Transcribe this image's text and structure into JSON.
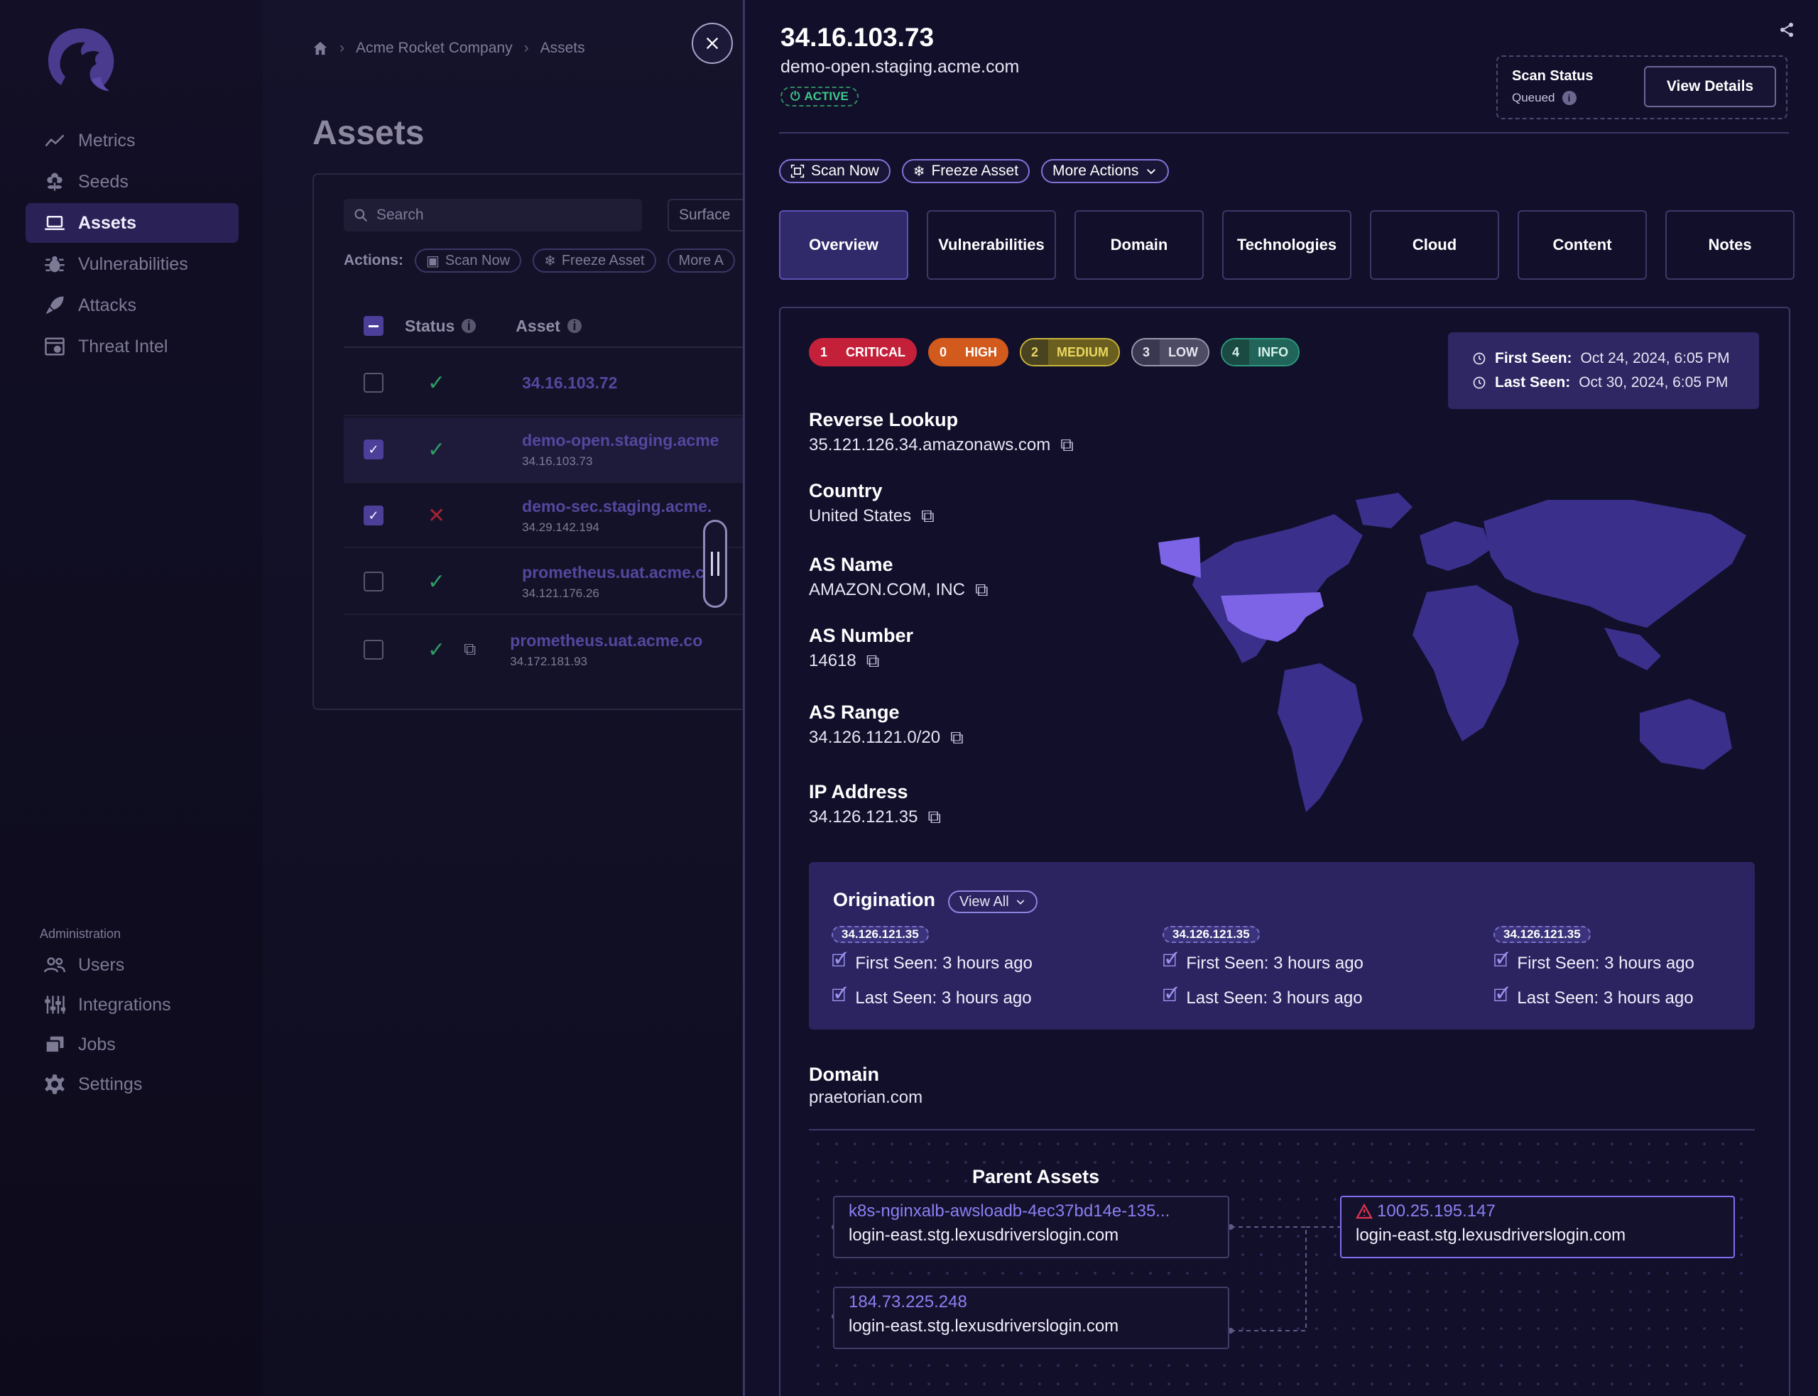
{
  "sidebar": {
    "nav": [
      {
        "label": "Metrics",
        "icon": "chart-line-icon"
      },
      {
        "label": "Seeds",
        "icon": "flower-icon"
      },
      {
        "label": "Assets",
        "icon": "laptop-icon",
        "active": true
      },
      {
        "label": "Vulnerabilities",
        "icon": "bug-icon"
      },
      {
        "label": "Attacks",
        "icon": "rocket-icon"
      },
      {
        "label": "Threat Intel",
        "icon": "browser-icon"
      }
    ],
    "admin_title": "Administration",
    "admin_nav": [
      {
        "label": "Users",
        "icon": "users-icon"
      },
      {
        "label": "Integrations",
        "icon": "sliders-icon"
      },
      {
        "label": "Jobs",
        "icon": "stack-icon"
      },
      {
        "label": "Settings",
        "icon": "gear-icon"
      }
    ]
  },
  "main": {
    "breadcrumb": [
      "Acme Rocket Company",
      "Assets"
    ],
    "title": "Assets",
    "search_placeholder": "Search",
    "surface_label": "Surface",
    "actions_label": "Actions:",
    "actions": [
      "Scan Now",
      "Freeze Asset",
      "More A"
    ],
    "columns": {
      "status": "Status",
      "asset": "Asset"
    },
    "rows": [
      {
        "name": "34.16.103.72",
        "sub": "",
        "checked": false,
        "status": "ok"
      },
      {
        "name": "demo-open.staging.acme",
        "sub": "34.16.103.73",
        "checked": true,
        "status": "ok"
      },
      {
        "name": "demo-sec.staging.acme.",
        "sub": "34.29.142.194",
        "checked": true,
        "status": "fail"
      },
      {
        "name": "prometheus.uat.acme.co",
        "sub": "34.121.176.26",
        "checked": false,
        "status": "ok"
      },
      {
        "name": "prometheus.uat.acme.co",
        "sub": "34.172.181.93",
        "checked": false,
        "status": "ok"
      }
    ]
  },
  "panel": {
    "ip": "34.16.103.73",
    "hostname": "demo-open.staging.acme.com",
    "badge": "ACTIVE",
    "scan_status_title": "Scan Status",
    "scan_status_value": "Queued",
    "view_details": "View Details",
    "actions": [
      "Scan Now",
      "Freeze Asset",
      "More Actions"
    ],
    "tabs": [
      "Overview",
      "Vulnerabilities",
      "Domain",
      "Technologies",
      "Cloud",
      "Content",
      "Notes"
    ],
    "severity": [
      {
        "count": "1",
        "label": "CRITICAL",
        "color": "#c4203a"
      },
      {
        "count": "0",
        "label": "HIGH",
        "color": "#d25a1c"
      },
      {
        "count": "2",
        "label": "MEDIUM",
        "color": "#c8b53a"
      },
      {
        "count": "3",
        "label": "LOW",
        "color": "#9a98ad"
      },
      {
        "count": "4",
        "label": "INFO",
        "color": "#2c9a7c"
      }
    ],
    "first_seen_label": "First Seen:",
    "first_seen": "Oct 24, 2024, 6:05 PM",
    "last_seen_label": "Last Seen:",
    "last_seen": "Oct 30, 2024, 6:05 PM",
    "details": [
      {
        "label": "Reverse Lookup",
        "value": "35.121.126.34.amazonaws.com"
      },
      {
        "label": "Country",
        "value": "United States"
      },
      {
        "label": "AS Name",
        "value": "AMAZON.COM, INC"
      },
      {
        "label": "AS Number",
        "value": "14618"
      },
      {
        "label": "AS Range",
        "value": "34.126.1121.0/20"
      },
      {
        "label": "IP Address",
        "value": "34.126.121.35"
      }
    ],
    "origination": {
      "title": "Origination",
      "view_all": "View All",
      "items": [
        {
          "ip": "34.126.121.35",
          "first": "First Seen: 3 hours ago",
          "last": "Last Seen: 3 hours ago"
        },
        {
          "ip": "34.126.121.35",
          "first": "First Seen: 3 hours ago",
          "last": "Last Seen: 3 hours ago"
        },
        {
          "ip": "34.126.121.35",
          "first": "First Seen: 3 hours ago",
          "last": "Last Seen: 3 hours ago"
        }
      ]
    },
    "domain_label": "Domain",
    "domain_value": "praetorian.com",
    "graph": {
      "parent_title": "Parent Assets",
      "nodes": [
        {
          "a": "k8s-nginxalb-awsloadb-4ec37bd14e-135...",
          "b": "login-east.stg.lexusdriverslogin.com"
        },
        {
          "a": "184.73.225.248",
          "b": "login-east.stg.lexusdriverslogin.com"
        },
        {
          "a": "100.25.195.147",
          "b": "login-east.stg.lexusdriverslogin.com"
        }
      ]
    }
  }
}
